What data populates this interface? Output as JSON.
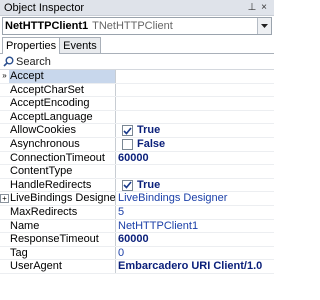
{
  "window": {
    "title": "Object Inspector",
    "pin_glyph": "⊥",
    "close_glyph": "×"
  },
  "selector": {
    "component_name": "NetHTTPClient1",
    "component_type": "TNetHTTPClient"
  },
  "tabs": [
    {
      "label": "Properties",
      "active": true
    },
    {
      "label": "Events",
      "active": false
    }
  ],
  "search": {
    "placeholder": "Search"
  },
  "colors": {
    "selected_row": "#c8d7ec",
    "bold_value": "#0a1f7a",
    "link_value": "#1b3fa8"
  },
  "properties": [
    {
      "name": "Accept",
      "value": "",
      "selected": true,
      "marker": "»"
    },
    {
      "name": "AcceptCharSet",
      "value": ""
    },
    {
      "name": "AcceptEncoding",
      "value": ""
    },
    {
      "name": "AcceptLanguage",
      "value": ""
    },
    {
      "name": "AllowCookies",
      "value": "True",
      "checkbox": true,
      "checked": true
    },
    {
      "name": "Asynchronous",
      "value": "False",
      "checkbox": true,
      "checked": false
    },
    {
      "name": "ConnectionTimeout",
      "value": "60000"
    },
    {
      "name": "ContentType",
      "value": ""
    },
    {
      "name": "HandleRedirects",
      "value": "True",
      "checkbox": true,
      "checked": true
    },
    {
      "name": "LiveBindings Designer",
      "value": "LiveBindings Designer",
      "expandable": true
    },
    {
      "name": "MaxRedirects",
      "value": "5"
    },
    {
      "name": "Name",
      "value": "NetHTTPClient1"
    },
    {
      "name": "ResponseTimeout",
      "value": "60000"
    },
    {
      "name": "Tag",
      "value": "0"
    },
    {
      "name": "UserAgent",
      "value": "Embarcadero URI Client/1.0"
    }
  ]
}
